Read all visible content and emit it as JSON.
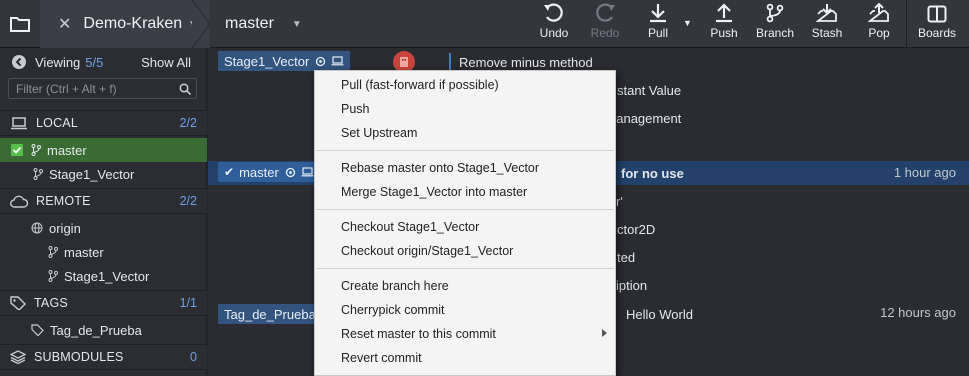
{
  "app": {
    "repo_tab": "Demo-Kraken",
    "branch_tab": "master"
  },
  "toolbar": {
    "undo": "Undo",
    "redo": "Redo",
    "pull": "Pull",
    "push": "Push",
    "branch": "Branch",
    "stash": "Stash",
    "pop": "Pop",
    "boards": "Boards"
  },
  "sidebar": {
    "viewing_label": "Viewing",
    "viewing_count": "5/5",
    "show_all": "Show All",
    "filter_placeholder": "Filter (Ctrl + Alt + f)",
    "local": {
      "label": "LOCAL",
      "count": "2/2",
      "items": [
        "master",
        "Stage1_Vector"
      ]
    },
    "remote": {
      "label": "REMOTE",
      "count": "2/2",
      "remote_name": "origin",
      "items": [
        "master",
        "Stage1_Vector"
      ]
    },
    "tags": {
      "label": "TAGS",
      "count": "1/1",
      "items": [
        "Tag_de_Prueba"
      ]
    },
    "submodules": {
      "label": "SUBMODULES",
      "count": "0"
    }
  },
  "graph": {
    "rows": [
      {
        "ref": "Stage1_Vector",
        "msg": "Remove minus method",
        "time": ""
      },
      {
        "ref": "",
        "msg": "stant Value",
        "time": ""
      },
      {
        "ref": "",
        "msg": "nanagement",
        "time": ""
      },
      {
        "ref": "master",
        "msg": "for no use",
        "time": "1 hour ago"
      },
      {
        "ref": "",
        "msg": "r'",
        "time": ""
      },
      {
        "ref": "",
        "msg": "ctor2D",
        "time": ""
      },
      {
        "ref": "",
        "msg": "ted",
        "time": ""
      },
      {
        "ref": "",
        "msg": "iption",
        "time": ""
      },
      {
        "ref": "Tag_de_Prueba",
        "msg": "Hello World",
        "time": "12 hours ago"
      }
    ]
  },
  "context_menu": {
    "items": [
      "Pull (fast-forward if possible)",
      "Push",
      "Set Upstream",
      "Rebase master onto Stage1_Vector",
      "Merge Stage1_Vector into master",
      "Checkout Stage1_Vector",
      "Checkout origin/Stage1_Vector",
      "Create branch here",
      "Cherrypick commit",
      "Reset master to this commit",
      "Revert commit"
    ]
  },
  "colors": {
    "accent": "#33547f",
    "highlight": "#23416b",
    "active_local": "#3a6b35",
    "count": "#6ba2e8"
  }
}
